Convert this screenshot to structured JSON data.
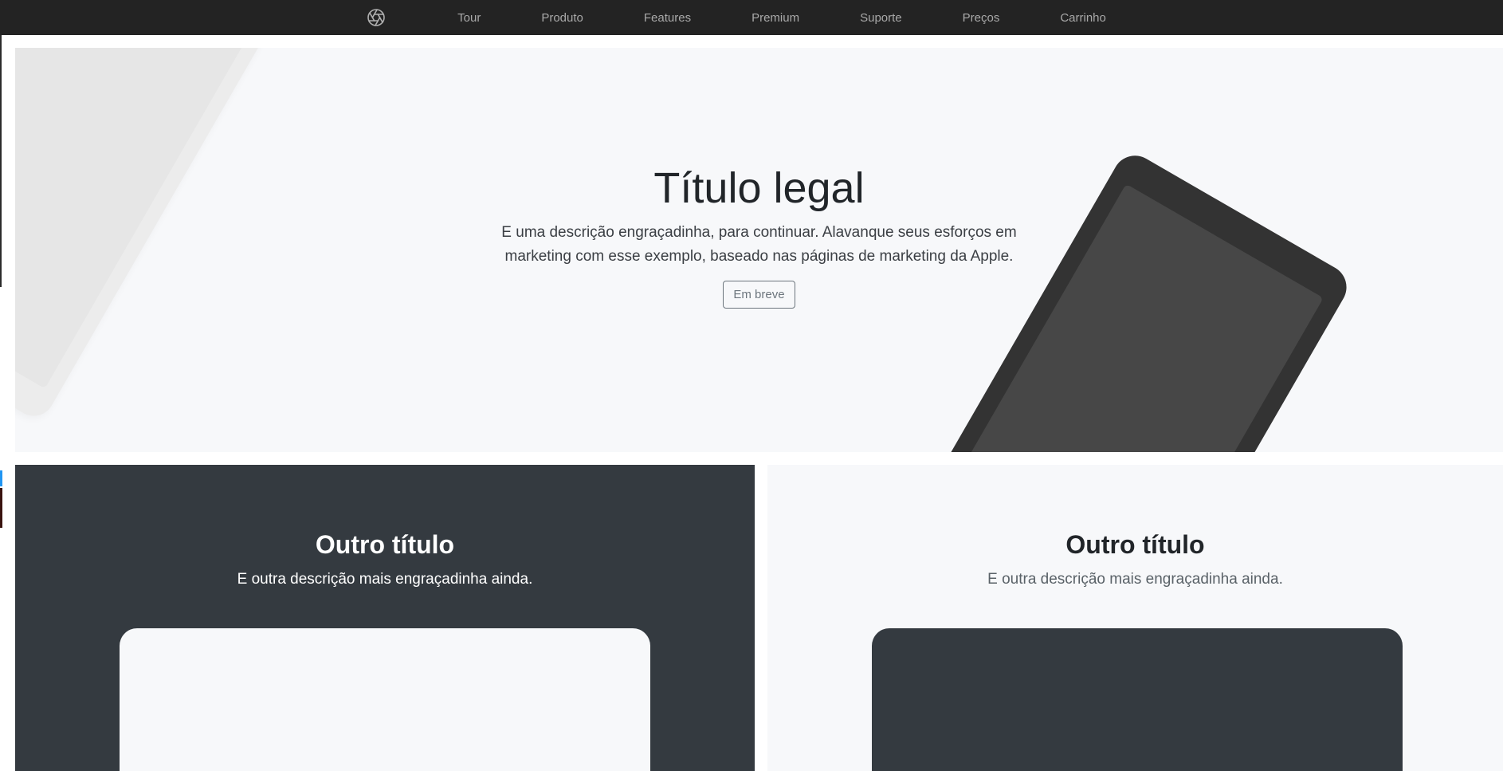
{
  "nav": {
    "logo_icon": "aperture-icon",
    "links": [
      "Tour",
      "Produto",
      "Features",
      "Premium",
      "Suporte",
      "Preços",
      "Carrinho"
    ]
  },
  "hero": {
    "title": "Título legal",
    "description": "E uma descrição engraçadinha, para continuar. Alavanque seus esforços em marketing com esse exemplo, baseado nas páginas de marketing da Apple.",
    "button_label": "Em breve"
  },
  "panels": [
    {
      "title": "Outro título",
      "description": "E outra descrição mais engraçadinha ainda.",
      "theme": "dark"
    },
    {
      "title": "Outro título",
      "description": "E outra descrição mais engraçadinha ainda.",
      "theme": "light"
    }
  ],
  "colors": {
    "nav_bg": "#232323",
    "nav_link": "#a9a9a9",
    "hero_bg": "#f7f8fa",
    "dark_panel": "#343a40",
    "device_dark": "#333333",
    "device_light": "#ececec"
  }
}
